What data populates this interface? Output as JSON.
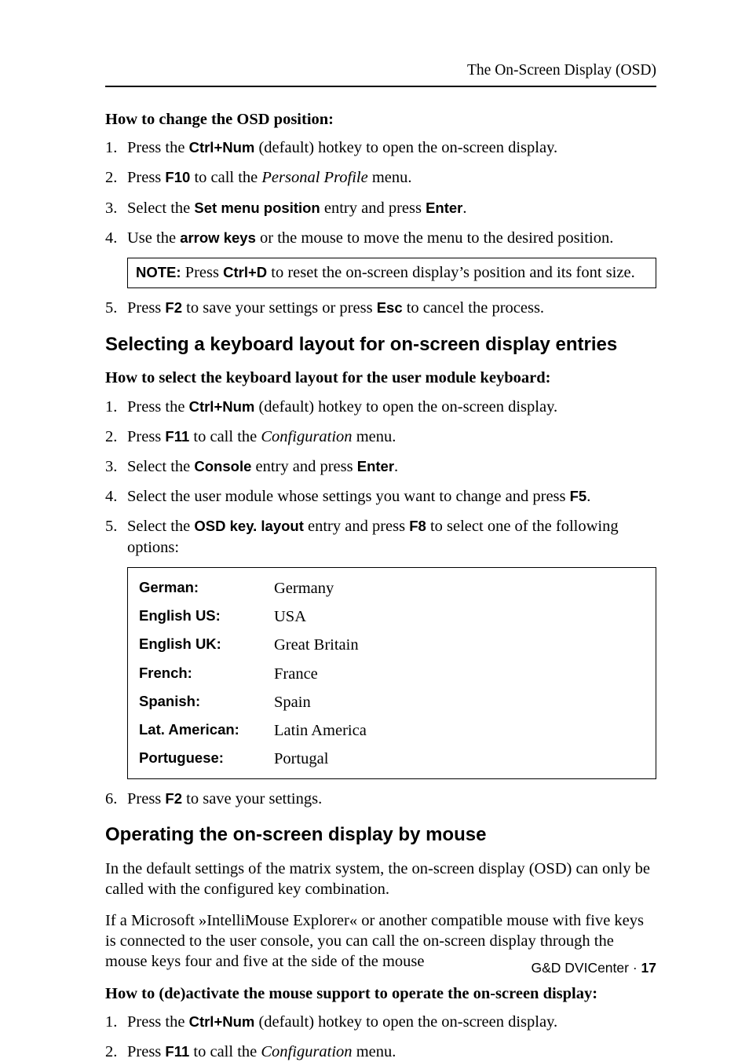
{
  "header": {
    "running_title": "The On-Screen Display (OSD)"
  },
  "section1": {
    "subheading": "How to change the OSD position:",
    "steps": {
      "s1": {
        "num": "1.",
        "pre": "Press the ",
        "key": "Ctrl+Num",
        "post": " (default) hotkey to open the on-screen display."
      },
      "s2": {
        "num": "2.",
        "pre": "Press ",
        "key": "F10",
        "mid": " to call the ",
        "ital": "Personal Profile",
        "post": " menu."
      },
      "s3": {
        "num": "3.",
        "pre": "Select the ",
        "key1": "Set menu position",
        "mid": " entry and press ",
        "key2": "Enter",
        "post": "."
      },
      "s4": {
        "num": "4.",
        "pre": "Use the ",
        "key": "arrow keys",
        "post": " or the mouse to move the menu to the desired position."
      },
      "note": {
        "label": "NOTE:",
        "pre": " Press ",
        "key": "Ctrl+D",
        "post": " to reset the on-screen display’s position and its font size."
      },
      "s5": {
        "num": "5.",
        "pre": "Press ",
        "key1": "F2",
        "mid": " to save your settings or press ",
        "key2": "Esc",
        "post": " to cancel the process."
      }
    }
  },
  "section2": {
    "heading": "Selecting a keyboard layout for on-screen display entries",
    "subheading": "How to select the keyboard layout for the user module keyboard:",
    "steps": {
      "s1": {
        "num": "1.",
        "pre": "Press the ",
        "key": "Ctrl+Num",
        "post": " (default) hotkey to open the on-screen display."
      },
      "s2": {
        "num": "2.",
        "pre": "Press ",
        "key": "F11",
        "mid": " to call the ",
        "ital": "Configuration",
        "post": " menu."
      },
      "s3": {
        "num": "3.",
        "pre": "Select the ",
        "key1": "Console",
        "mid": " entry and press ",
        "key2": "Enter",
        "post": "."
      },
      "s4": {
        "num": "4.",
        "pre": "Select the user module whose settings you want to change and press ",
        "key": "F5",
        "post": "."
      },
      "s5": {
        "num": "5.",
        "pre": "Select the ",
        "key1": "OSD key. layout",
        "mid": " entry and press ",
        "key2": "F8",
        "post": " to select one of the following options:"
      }
    },
    "table": {
      "r1": {
        "label": "German:",
        "value": "Germany"
      },
      "r2": {
        "label": "English US:",
        "value": "USA"
      },
      "r3": {
        "label": "English UK:",
        "value": "Great Britain"
      },
      "r4": {
        "label": "French:",
        "value": "France"
      },
      "r5": {
        "label": "Spanish:",
        "value": "Spain"
      },
      "r6": {
        "label": "Lat. American:",
        "value": "Latin America"
      },
      "r7": {
        "label": "Portuguese:",
        "value": "Portugal"
      }
    },
    "s6": {
      "num": "6.",
      "pre": "Press ",
      "key": "F2",
      "post": " to save your settings."
    }
  },
  "section3": {
    "heading": "Operating the on-screen display by mouse",
    "p1": "In the default settings of the matrix system, the on-screen display (OSD) can only be called with the configured key combination.",
    "p2": "If a Microsoft »IntelliMouse Explorer« or another compatible mouse with five keys is connected to the user console, you can call the on-screen display through the mouse keys four and five at the side of the mouse",
    "subheading": "How to (de)activate the mouse support to operate the on-screen display:",
    "steps": {
      "s1": {
        "num": "1.",
        "pre": "Press the ",
        "key": "Ctrl+Num",
        "post": " (default) hotkey to open the on-screen display."
      },
      "s2": {
        "num": "2.",
        "pre": "Press ",
        "key": "F11",
        "mid": " to call the ",
        "ital": "Configuration",
        "post": " menu."
      }
    }
  },
  "footer": {
    "product": "G&D DVICenter · ",
    "page": "17"
  }
}
